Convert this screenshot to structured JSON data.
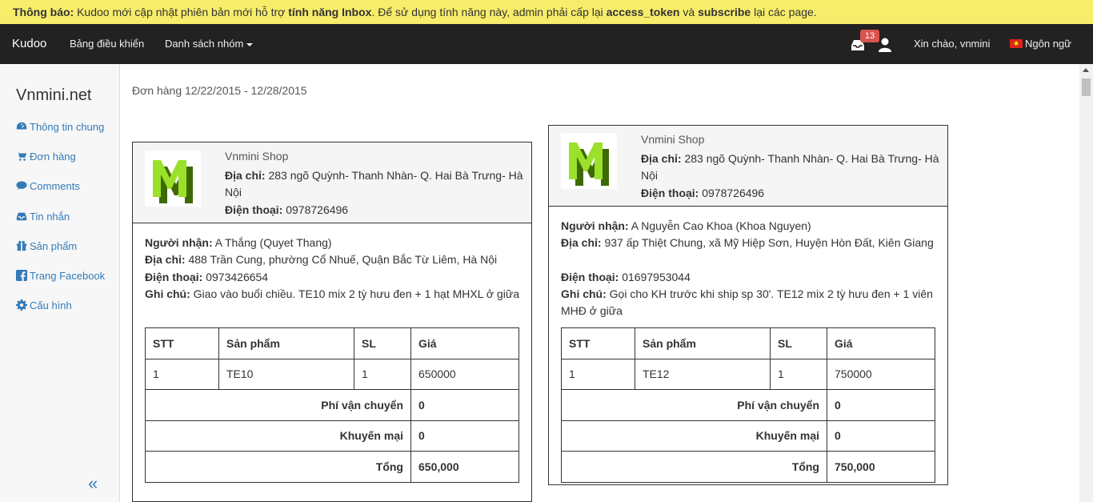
{
  "notice": {
    "label": "Thông báo:",
    "text1": " Kudoo mới cập nhật phiên bản mới hỗ trợ ",
    "feature": "tính năng Inbox",
    "text2": ". Để sử dụng tính năng này, admin phải cấp lại ",
    "token": "access_token",
    "text3": " và ",
    "subscribe": "subscribe",
    "text4": " lại các page."
  },
  "navbar": {
    "brand": "Kudoo",
    "dashboard": "Bảng điều khiển",
    "groups": "Danh sách nhóm",
    "inbox_count": "13",
    "greeting": "Xin chào, vnmini",
    "language": "Ngôn ngữ"
  },
  "sidebar": {
    "site": "Vnmini.net",
    "items": [
      {
        "label": "Thông tin chung",
        "icon": "dashboard-icon"
      },
      {
        "label": "Đơn hàng",
        "icon": "cart-icon"
      },
      {
        "label": "Comments",
        "icon": "comments-icon"
      },
      {
        "label": "Tin nhắn",
        "icon": "inbox-icon"
      },
      {
        "label": "Sản phẩm",
        "icon": "gift-icon"
      },
      {
        "label": "Trang Facebook",
        "icon": "facebook-icon"
      },
      {
        "label": "Cấu hình",
        "icon": "gear-icon"
      }
    ],
    "collapse": "«"
  },
  "page": {
    "title": "Đơn hàng 12/22/2015 - 12/28/2015"
  },
  "labels": {
    "address": "Địa chỉ:",
    "phone": "Điện thoại:",
    "recipient": "Người nhận:",
    "note": "Ghi chú:",
    "col_stt": "STT",
    "col_product": "Sản phẩm",
    "col_qty": "SL",
    "col_price": "Giá",
    "shipping": "Phí vận chuyển",
    "discount": "Khuyến mại",
    "total": "Tổng"
  },
  "orders": [
    {
      "shop_name": "Vnmini Shop",
      "shop_address": " 283 ngõ Quỳnh- Thanh Nhàn- Q. Hai Bà Trưng- Hà Nội",
      "shop_phone": " 0978726496",
      "recipient": " A Thắng (Quyet Thang)",
      "address": " 488 Trần Cung, phường Cổ Nhuế, Quận Bắc Từ Liêm, Hà Nội",
      "phone": " 0973426654",
      "note": " Giao vào buổi chiều. TE10 mix 2 tỳ hưu đen + 1 hạt MHXL ở giữa",
      "item": {
        "stt": "1",
        "product": "TE10",
        "qty": "1",
        "price": "650000"
      },
      "shipping": "0",
      "discount": "0",
      "total": "650,000"
    },
    {
      "shop_name": "Vnmini Shop",
      "shop_address": " 283 ngõ Quỳnh- Thanh Nhàn- Q. Hai Bà Trưng- Hà Nội",
      "shop_phone": " 0978726496",
      "recipient": " A Nguyễn Cao Khoa (Khoa Nguyen)",
      "address": " 937 ấp Thiệt Chung, xã Mỹ Hiệp Sơn, Huyện Hòn Đất, Kiên Giang",
      "phone": " 01697953044",
      "note": " Gọi cho KH trước khi ship sp 30'. TE12 mix 2 tỳ hưu đen + 1 viên MHĐ ở giữa",
      "item": {
        "stt": "1",
        "product": "TE12",
        "qty": "1",
        "price": "750000"
      },
      "shipping": "0",
      "discount": "0",
      "total": "750,000"
    }
  ]
}
